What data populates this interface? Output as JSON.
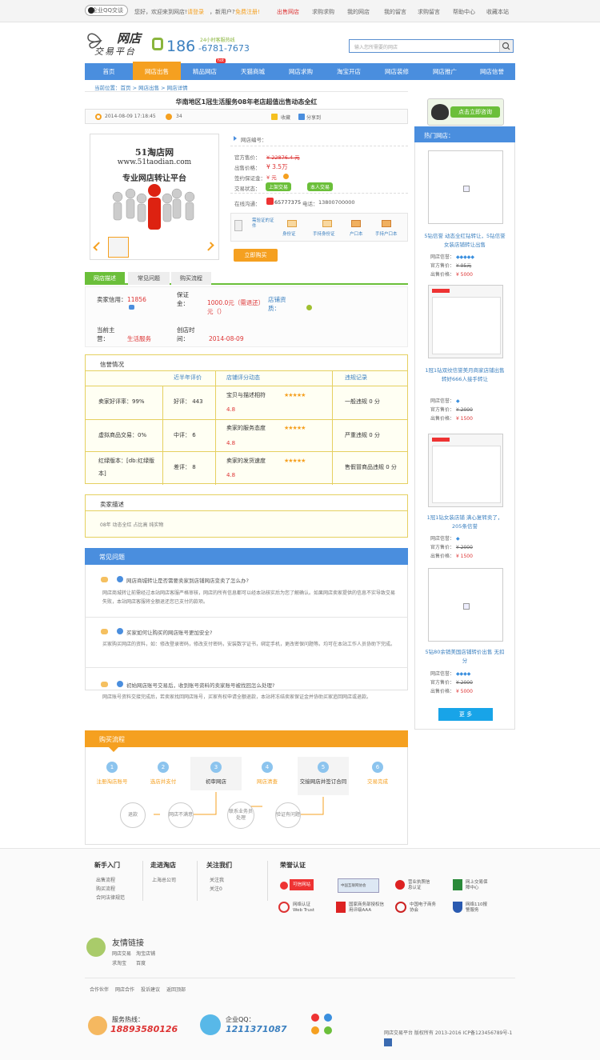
{
  "topbar": {
    "qq_label": "企业QQ交谈",
    "welcome": "您好，欢迎来到网店!",
    "login": "请登录",
    "or_text": "，新用户?",
    "register": "免费注册!",
    "links": [
      "出售网店",
      "求购求购",
      "我的网店",
      "我的留言",
      "求购留言",
      "帮助中心",
      "收藏本站"
    ]
  },
  "header": {
    "logo_title": "网店",
    "logo_sub": "交易平台",
    "phone_prefix": "186",
    "phone_rest": "-6781-7673",
    "phone_note": "24小时客服热线",
    "search_placeholder": "输入您所需要的网店"
  },
  "nav": [
    "首页",
    "网店出售",
    "精品网店",
    "天猫商城",
    "网店求购",
    "淘宝开店",
    "网店装修",
    "网店推广",
    "网店信誉"
  ],
  "nav_hot": "hot",
  "breadcrumb": "当前位置：首页 > 网店出售 > 网店详情",
  "listing": {
    "title": "华南地区1冠生活服务08年老店超值出售动态全红",
    "date": "2014-08-09 17:18:45",
    "views": "34",
    "favorite": "收藏",
    "share": "分享到",
    "image_line1": "51淘店网",
    "image_line2": "www.51taodian.com",
    "image_line3": "专业网店转让平台",
    "shop_no_label": "网店编号：",
    "price_orig_label": "官方售价：",
    "price_orig": "¥ 22876.4 元",
    "price_sale_label": "出售价格：",
    "price_sale": "¥ 3.5万",
    "deposit_label": "签约保证金：",
    "deposit": "¥ 元",
    "trade_status_label": "交易状态：",
    "badge1": "上架交易",
    "badge2": "本人交易",
    "contact_label": "在线沟通：",
    "qq": "65777375",
    "tel_label": "电话：",
    "tel": "13800700000",
    "verify_items": [
      "需验证的证件",
      "身份证",
      "手持身份证",
      "户口本",
      "手持户口本"
    ],
    "buy_button": "立即购买"
  },
  "tabs": [
    "网店描述",
    "常见问题",
    "购买流程"
  ],
  "shop_info": {
    "seller_credit_label": "卖家信用：",
    "seller_credit": "11856",
    "guarantee_label": "保证金：",
    "guarantee": "1000.0元（需退还）元（）",
    "qualification_label": "店铺资质：",
    "category_label": "当前主营：",
    "category": "生活服务",
    "created_label": "创店时间：",
    "created": "2014-08-09"
  },
  "credit": {
    "title": "信誉情况",
    "col_headers": [
      "近半年评价",
      "店铺评分动态",
      "违规记录"
    ],
    "rows": [
      {
        "left": "卖家好评率：99%",
        "review": "好评： 443",
        "score_label": "宝贝与描述相符",
        "score": "4.8",
        "violation": "一般违规 0 分"
      },
      {
        "left": "虚拟商品交易：0%",
        "review": "中评： 6",
        "score_label": "卖家的服务态度",
        "score": "4.8",
        "violation": "严重违规 0 分"
      },
      {
        "left": "红绿版本：[db:红绿版本]",
        "review": "差评： 8",
        "score_label": "卖家的发货速度",
        "score": "4.8",
        "violation": "售假冒商品违规 0 分"
      }
    ]
  },
  "desc": {
    "title": "卖家描述",
    "text": "08年 动态全红 占比高 纯实物"
  },
  "faq": {
    "title": "常见问题",
    "items": [
      {
        "q": "网店商城转让是否需要卖家到店铺网店变卖了怎么办?",
        "a": "网店商城转让前需经过本站网店客服严格审核，网店的所有信息都可以经本站核实后为您了解确认。如果网店卖家提供的信息不实导致交易失败，本站网店客服将全额退还您已支付的款项。"
      },
      {
        "q": "买家如何让购买的网店账号更加安全?",
        "a": "买家购买网店的资料，如：修改登录密码，修改支付密码，安装数字证书，绑定手机，更改密保问题等。均可在本站工作人员协助下完成。"
      },
      {
        "q": "初始网店账号交易后，收到账号资料的卖家账号被找回怎么处理?",
        "a": "网店账号资料交接完成后，若卖家找回网店账号，买家有权申请全额退款，本站将冻结卖家保证金并协助买家追回网店或退款。"
      }
    ]
  },
  "process": {
    "title": "购买流程",
    "steps": [
      {
        "n": "1",
        "label": "注册淘店账号"
      },
      {
        "n": "2",
        "label": "选店并支付"
      },
      {
        "n": "3",
        "label": "初审网店"
      },
      {
        "n": "4",
        "label": "网店清查"
      },
      {
        "n": "5",
        "label": "交接网店并签订合同"
      },
      {
        "n": "6",
        "label": "交易完成"
      }
    ],
    "branches": [
      "退款",
      "网店不满意",
      "联系业务员处理",
      "验证有问题"
    ]
  },
  "sidebar": {
    "consult": "点击立即咨询",
    "hot_title": "热门网店：",
    "items": [
      {
        "title": "5钻信誉 动态全红钻转让，5钻信誉女装店铺转让出售",
        "credit_label": "网店信誉：",
        "orig_label": "官方售价：",
        "orig": "¥ 95元",
        "sale_label": "出售价格：",
        "sale": "¥ 5000"
      },
      {
        "title": "1冠1钻双纹信誉美月商家店铺出售转好666人接手转让",
        "credit_label": "网店信誉：",
        "orig_label": "官方售价：",
        "orig": "¥ 2000",
        "sale_label": "出售价格：",
        "sale": "¥ 1500"
      },
      {
        "title": "1冠1钻女装店铺 满心复转卖了，205条信誉",
        "credit_label": "网店信誉：",
        "orig_label": "官方售价：",
        "orig": "¥ 2000",
        "sale_label": "出售价格：",
        "sale": "¥ 1500"
      },
      {
        "title": "5钻80余销美国店铺转价出售 无扣分",
        "credit_label": "网店信誉：",
        "orig_label": "官方售价：",
        "orig": "¥ 2000",
        "sale_label": "出售价格：",
        "sale": "¥ 5000"
      }
    ],
    "more": "更 多"
  },
  "footer": {
    "col1_title": "新手入门",
    "col1": [
      "出售流程",
      "购买流程",
      "合同法律规范"
    ],
    "col2_title": "走进淘店",
    "col2": [
      "上海总公司"
    ],
    "col3_title": "关注我们",
    "col3": [
      "关注我",
      "关注0"
    ],
    "cert_title": "荣誉认证",
    "certs": [
      "可信网站",
      "中国互联网协会",
      "营业执照信息认证",
      "网上交易保障中心",
      "网络认证 Web Trust",
      "国家商务部授权信用评级AAA",
      "中国电子商务协会",
      "网络110报警服务"
    ],
    "friend_title": "友情链接",
    "friend_links": [
      "网店交易",
      "淘宝店铺",
      "求淘宝",
      "百度"
    ],
    "bottom_links": [
      "合作伙伴",
      "网店合作",
      "投诉建议",
      "返回顶部"
    ],
    "service_label": "服务热线：",
    "service_tel": "18893580126",
    "qq_label": "企业QQ：",
    "qq_num": "1211371087",
    "copyright": "网店交易平台 版权所有 2013-2016 ICP备123456789号-1"
  },
  "colors": {
    "primary_blue": "#4a8ede",
    "accent_orange": "#f5a020",
    "green": "#6bbf3a",
    "price_red": "#dd3333"
  }
}
